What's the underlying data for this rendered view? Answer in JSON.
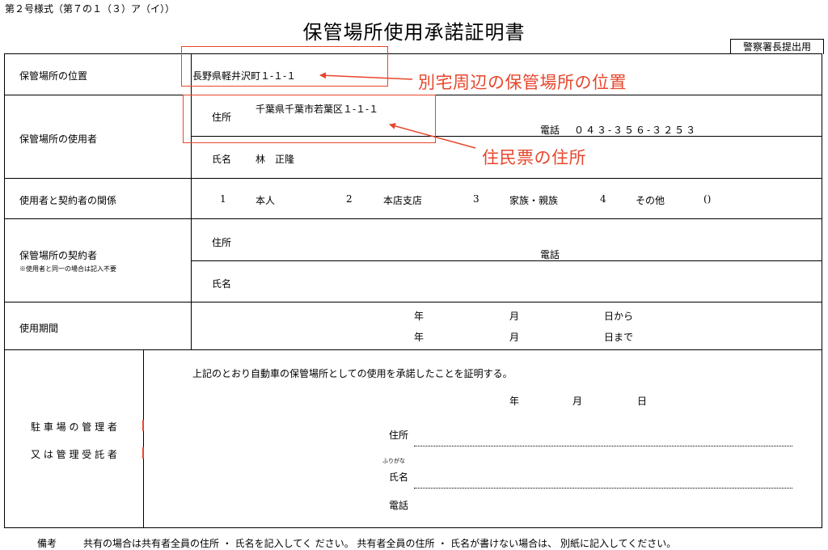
{
  "form_code": "第２号様式（第７の１（３）ア（イ））",
  "title": "保管場所使用承諾証明書",
  "submit_badge": "警察署長提出用",
  "location": {
    "label": "保管場所の位置",
    "value": "長野県軽井沢町１-１-１"
  },
  "user": {
    "label": "保管場所の使用者",
    "address_label": "住所",
    "address_value": "千葉県千葉市若葉区１-１-１",
    "phone_label": "電話",
    "phone_value": "０４３-３５６-３２５３",
    "name_label": "氏名",
    "name_value": "林　正隆"
  },
  "relation": {
    "label": "使用者と契約者の関係",
    "options": [
      {
        "num": "1",
        "text": "本人"
      },
      {
        "num": "2",
        "text": "本店支店"
      },
      {
        "num": "3",
        "text": "家族・親族"
      },
      {
        "num": "4",
        "text": "その他"
      }
    ],
    "paren": "()"
  },
  "contractor": {
    "label": "保管場所の契約者",
    "note": "※使用者と同一の場合は記入不要",
    "address_label": "住所",
    "phone_label": "電話",
    "name_label": "氏名"
  },
  "period": {
    "label": "使用期間",
    "year": "年",
    "month": "月",
    "from": "日から",
    "to": "日まで"
  },
  "manager": {
    "label_line1": "駐 車 場 の 管 理 者",
    "label_line2": "又 は 管 理 受 託 者",
    "statement": "上記のとおり自動車の保管場所としての使用を承諾したことを証明する。",
    "year": "年",
    "month": "月",
    "day": "日",
    "address_label": "住所",
    "furigana": "ふりがな",
    "name_label": "氏名",
    "phone_label": "電話"
  },
  "remarks": {
    "label": "備考",
    "text": "共有の場合は共有者全員の住所 ・ 氏名を記入してく ださい。 共有者全員の住所 ・ 氏名が書けない場合は、 別紙に記入してください。"
  },
  "annotations": {
    "location_note": "別宅周辺の保管場所の位置",
    "address_note": "住民票の住所",
    "color": "#e8462c"
  }
}
